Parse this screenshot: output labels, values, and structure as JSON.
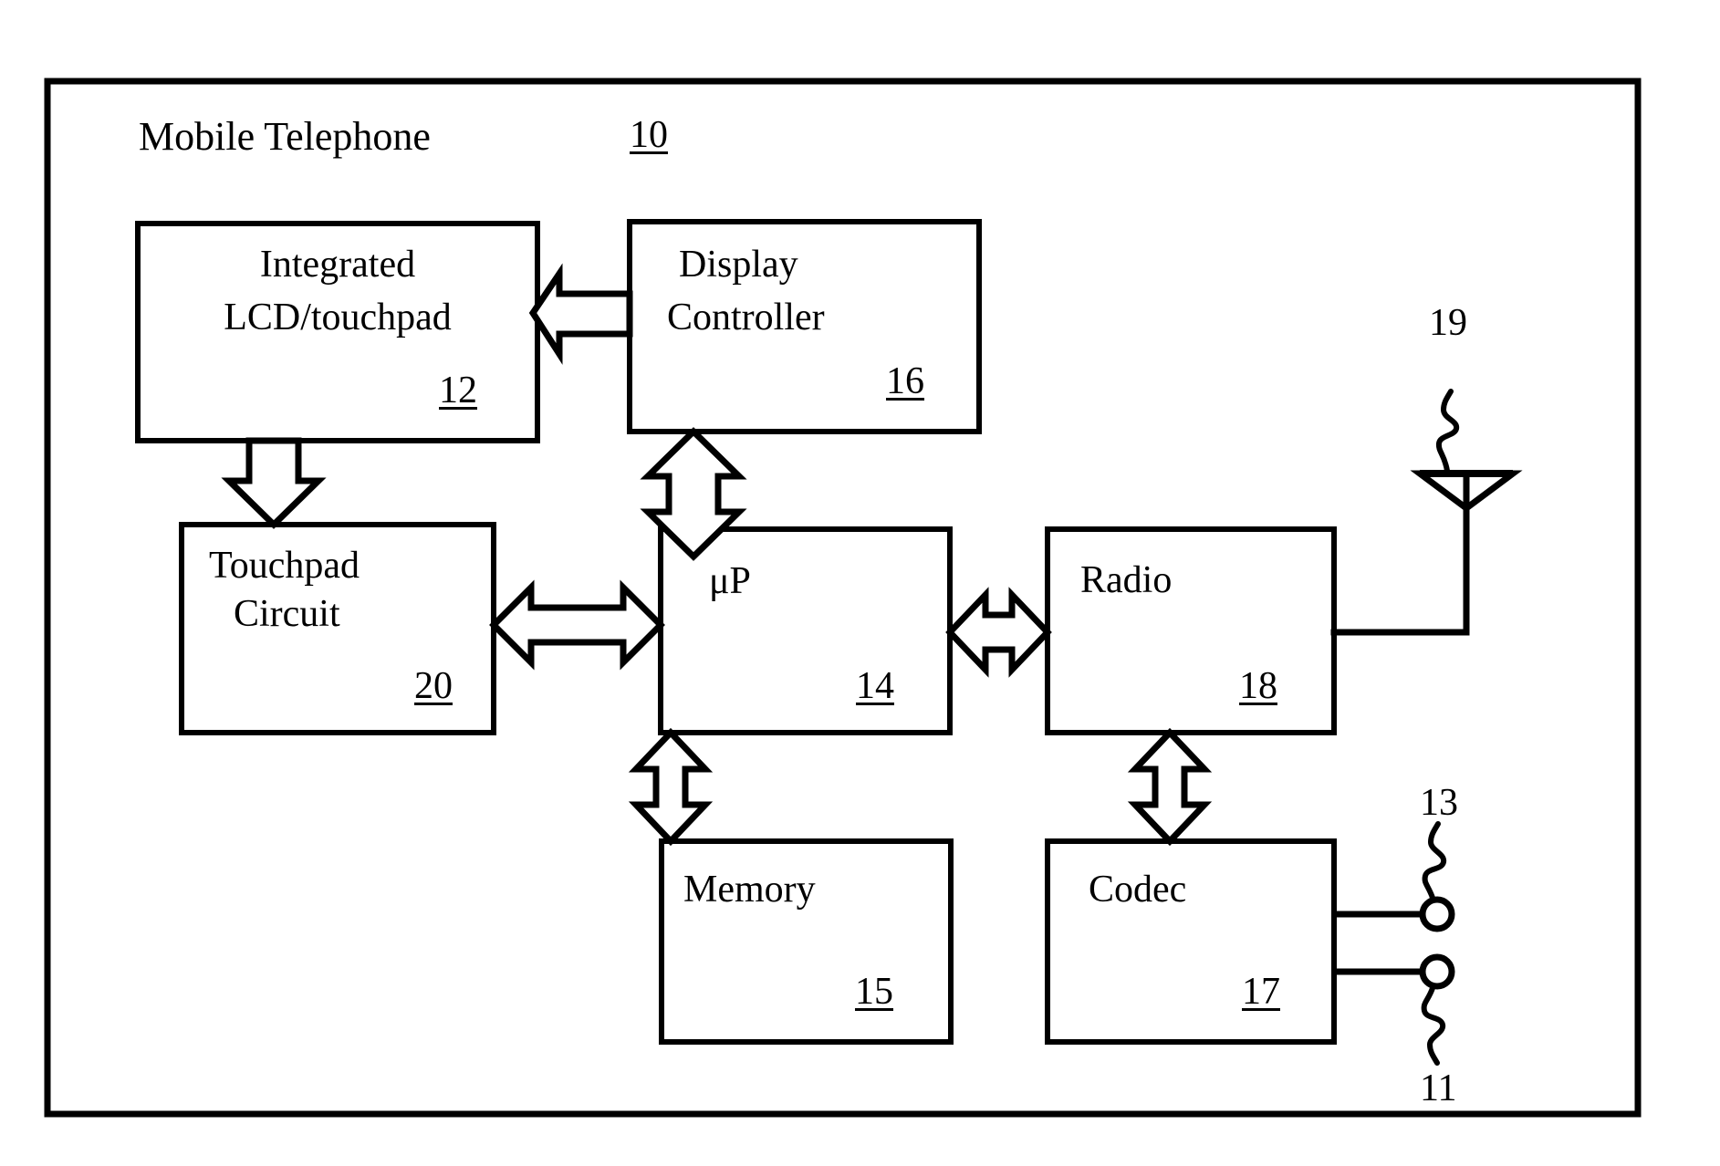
{
  "figure": {
    "kind": "patent-block-diagram",
    "outer_label": "Mobile Telephone",
    "outer_ref": "10",
    "line_color": "#000000",
    "background": "#ffffff"
  },
  "blocks": [
    {
      "id": "lcd",
      "label_line1": "Integrated",
      "label_line2": "LCD/touchpad",
      "ref": "12"
    },
    {
      "id": "display_controller",
      "label_line1": "Display",
      "label_line2": "Controller",
      "ref": "16"
    },
    {
      "id": "touchpad_circuit",
      "label_line1": "Touchpad",
      "label_line2": "Circuit",
      "ref": "20"
    },
    {
      "id": "microprocessor",
      "label_line1": "μP",
      "label_line2": "",
      "ref": "14"
    },
    {
      "id": "radio",
      "label_line1": "Radio",
      "label_line2": "",
      "ref": "18"
    },
    {
      "id": "memory",
      "label_line1": "Memory",
      "label_line2": "",
      "ref": "15"
    },
    {
      "id": "codec",
      "label_line1": "Codec",
      "label_line2": "",
      "ref": "17"
    }
  ],
  "external_refs": {
    "antenna": "19",
    "speaker": "13",
    "microphone": "11"
  },
  "connectors": [
    {
      "id": "display-controller-to-lcd",
      "style": "block-arrow",
      "direction": "left"
    },
    {
      "id": "lcd-to-touchpad-circuit",
      "style": "block-arrow",
      "direction": "down"
    },
    {
      "id": "display-controller-to-microprocessor",
      "style": "block-arrow",
      "direction": "bidirectional-vertical"
    },
    {
      "id": "touchpad-circuit-to-microprocessor",
      "style": "block-arrow",
      "direction": "bidirectional-horizontal"
    },
    {
      "id": "microprocessor-to-radio",
      "style": "block-arrow",
      "direction": "bidirectional-horizontal"
    },
    {
      "id": "microprocessor-to-memory",
      "style": "block-arrow",
      "direction": "bidirectional-vertical"
    },
    {
      "id": "radio-to-codec",
      "style": "block-arrow",
      "direction": "bidirectional-vertical"
    },
    {
      "id": "radio-to-antenna",
      "style": "plain-line",
      "direction": "none"
    },
    {
      "id": "codec-to-speaker",
      "style": "plain-line",
      "direction": "none"
    },
    {
      "id": "codec-to-microphone",
      "style": "plain-line",
      "direction": "none"
    }
  ]
}
